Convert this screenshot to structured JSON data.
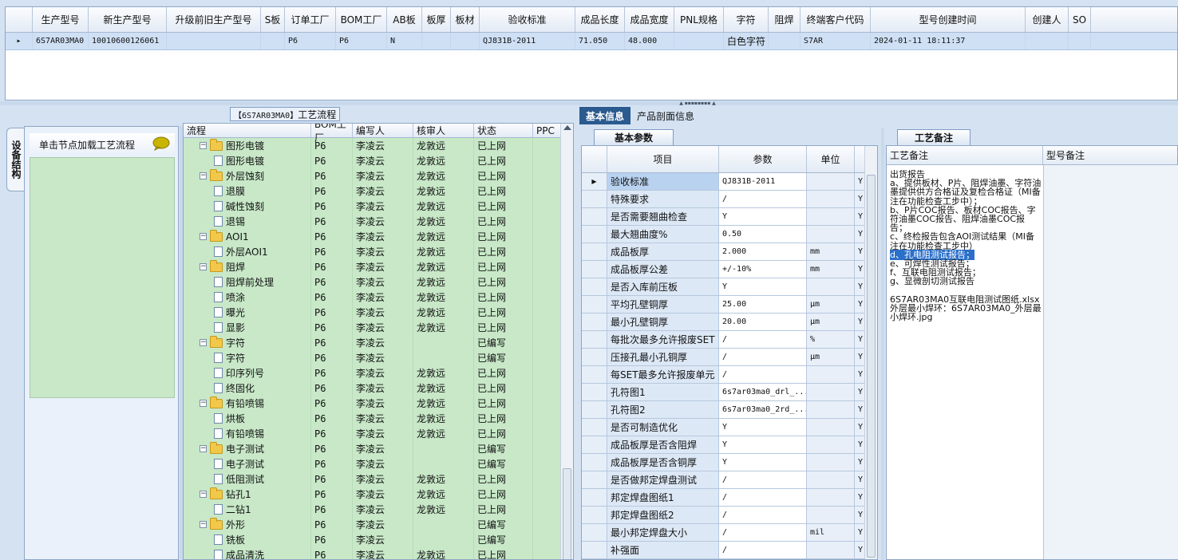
{
  "top_grid": {
    "headers": [
      "生产型号",
      "新生产型号",
      "升级前旧生产型号",
      "S板",
      "订单工厂",
      "BOM工厂",
      "AB板",
      "板厚",
      "板材",
      "验收标准",
      "成品长度",
      "成品宽度",
      "PNL规格",
      "字符",
      "阻焊",
      "终端客户代码",
      "型号创建时间",
      "创建人",
      "SO"
    ],
    "row": [
      "6S7AR03MA0",
      "10010600126061",
      "",
      "",
      "P6",
      "P6",
      "N",
      "",
      "",
      "QJ831B-2011",
      "71.050",
      "48.000",
      "",
      "白色字符",
      "",
      "S7AR",
      "2024-01-11 18:11:37",
      "",
      ""
    ]
  },
  "left": {
    "title_part": "【6S7AR03MA0】",
    "title_suffix": "工艺流程",
    "vtab_label": "设备结构",
    "load_label": "单击节点加载工艺流程",
    "tree_headers": [
      "流程",
      "BOM工厂",
      "编写人",
      "核审人",
      "状态",
      "PPC"
    ],
    "tree_rows": [
      {
        "label": "图形电镀",
        "level": 0,
        "bom": "P6",
        "writer": "李凌云",
        "reviewer": "龙敦远",
        "status": "已上网"
      },
      {
        "label": "图形电镀",
        "level": 1,
        "bom": "P6",
        "writer": "李凌云",
        "reviewer": "龙敦远",
        "status": "已上网"
      },
      {
        "label": "外层蚀刻",
        "level": 0,
        "bom": "P6",
        "writer": "李凌云",
        "reviewer": "龙敦远",
        "status": "已上网"
      },
      {
        "label": "退膜",
        "level": 1,
        "bom": "P6",
        "writer": "李凌云",
        "reviewer": "龙敦远",
        "status": "已上网"
      },
      {
        "label": "碱性蚀刻",
        "level": 1,
        "bom": "P6",
        "writer": "李凌云",
        "reviewer": "龙敦远",
        "status": "已上网"
      },
      {
        "label": "退锡",
        "level": 1,
        "bom": "P6",
        "writer": "李凌云",
        "reviewer": "龙敦远",
        "status": "已上网"
      },
      {
        "label": "AOI1",
        "level": 0,
        "bom": "P6",
        "writer": "李凌云",
        "reviewer": "龙敦远",
        "status": "已上网"
      },
      {
        "label": "外层AOI1",
        "level": 1,
        "bom": "P6",
        "writer": "李凌云",
        "reviewer": "龙敦远",
        "status": "已上网"
      },
      {
        "label": "阻焊",
        "level": 0,
        "bom": "P6",
        "writer": "李凌云",
        "reviewer": "龙敦远",
        "status": "已上网"
      },
      {
        "label": "阻焊前处理",
        "level": 1,
        "bom": "P6",
        "writer": "李凌云",
        "reviewer": "龙敦远",
        "status": "已上网"
      },
      {
        "label": "喷涂",
        "level": 1,
        "bom": "P6",
        "writer": "李凌云",
        "reviewer": "龙敦远",
        "status": "已上网"
      },
      {
        "label": "曝光",
        "level": 1,
        "bom": "P6",
        "writer": "李凌云",
        "reviewer": "龙敦远",
        "status": "已上网"
      },
      {
        "label": "显影",
        "level": 1,
        "bom": "P6",
        "writer": "李凌云",
        "reviewer": "龙敦远",
        "status": "已上网"
      },
      {
        "label": "字符",
        "level": 0,
        "bom": "P6",
        "writer": "李凌云",
        "reviewer": "",
        "status": "已编写"
      },
      {
        "label": "字符",
        "level": 1,
        "bom": "P6",
        "writer": "李凌云",
        "reviewer": "",
        "status": "已编写"
      },
      {
        "label": "印序列号",
        "level": 1,
        "bom": "P6",
        "writer": "李凌云",
        "reviewer": "龙敦远",
        "status": "已上网"
      },
      {
        "label": "终固化",
        "level": 1,
        "bom": "P6",
        "writer": "李凌云",
        "reviewer": "龙敦远",
        "status": "已上网"
      },
      {
        "label": "有铅喷锡",
        "level": 0,
        "bom": "P6",
        "writer": "李凌云",
        "reviewer": "龙敦远",
        "status": "已上网"
      },
      {
        "label": "烘板",
        "level": 1,
        "bom": "P6",
        "writer": "李凌云",
        "reviewer": "龙敦远",
        "status": "已上网"
      },
      {
        "label": "有铅喷锡",
        "level": 1,
        "bom": "P6",
        "writer": "李凌云",
        "reviewer": "龙敦远",
        "status": "已上网"
      },
      {
        "label": "电子测试",
        "level": 0,
        "bom": "P6",
        "writer": "李凌云",
        "reviewer": "",
        "status": "已编写"
      },
      {
        "label": "电子测试",
        "level": 1,
        "bom": "P6",
        "writer": "李凌云",
        "reviewer": "",
        "status": "已编写"
      },
      {
        "label": "低阻测试",
        "level": 1,
        "bom": "P6",
        "writer": "李凌云",
        "reviewer": "龙敦远",
        "status": "已上网"
      },
      {
        "label": "钻孔1",
        "level": 0,
        "bom": "P6",
        "writer": "李凌云",
        "reviewer": "龙敦远",
        "status": "已上网"
      },
      {
        "label": "二钻1",
        "level": 1,
        "bom": "P6",
        "writer": "李凌云",
        "reviewer": "龙敦远",
        "status": "已上网"
      },
      {
        "label": "外形",
        "level": 0,
        "bom": "P6",
        "writer": "李凌云",
        "reviewer": "",
        "status": "已编写"
      },
      {
        "label": "铣板",
        "level": 1,
        "bom": "P6",
        "writer": "李凌云",
        "reviewer": "",
        "status": "已编写"
      },
      {
        "label": "成品清洗",
        "level": 1,
        "bom": "P6",
        "writer": "李凌云",
        "reviewer": "龙敦远",
        "status": "已上网"
      }
    ]
  },
  "mid": {
    "tabs": [
      "基本信息",
      "产品剖面信息"
    ],
    "sub_tab": "基本参数",
    "headers": [
      "项目",
      "参数",
      "单位"
    ],
    "rows": [
      {
        "item": "验收标准",
        "value": "QJ831B-2011",
        "unit": "",
        "flag": "Y"
      },
      {
        "item": "特殊要求",
        "value": "/",
        "unit": "",
        "flag": "Y"
      },
      {
        "item": "是否需要翘曲检查",
        "value": "Y",
        "unit": "",
        "flag": "Y"
      },
      {
        "item": "最大翘曲度%",
        "value": "0.50",
        "unit": "",
        "flag": "Y"
      },
      {
        "item": "成品板厚",
        "value": "2.000",
        "unit": "mm",
        "flag": "Y"
      },
      {
        "item": "成品板厚公差",
        "value": "+/-10%",
        "unit": "mm",
        "flag": "Y"
      },
      {
        "item": "是否入库前压板",
        "value": "Y",
        "unit": "",
        "flag": "Y"
      },
      {
        "item": "平均孔壁铜厚",
        "value": "25.00",
        "unit": "μm",
        "flag": "Y"
      },
      {
        "item": "最小孔壁铜厚",
        "value": "20.00",
        "unit": "μm",
        "flag": "Y"
      },
      {
        "item": "每批次最多允许报废SET",
        "value": "/",
        "unit": "%",
        "flag": "Y"
      },
      {
        "item": "压接孔最小孔铜厚",
        "value": "/",
        "unit": "μm",
        "flag": "Y"
      },
      {
        "item": "每SET最多允许报废单元",
        "value": "/",
        "unit": "",
        "flag": "Y"
      },
      {
        "item": "孔符图1",
        "value": "6s7ar03ma0_drl_...",
        "unit": "",
        "flag": "Y"
      },
      {
        "item": "孔符图2",
        "value": "6s7ar03ma0_2rd_...",
        "unit": "",
        "flag": "Y"
      },
      {
        "item": "是否可制造优化",
        "value": "Y",
        "unit": "",
        "flag": "Y"
      },
      {
        "item": "成品板厚是否含阻焊",
        "value": "Y",
        "unit": "",
        "flag": "Y"
      },
      {
        "item": "成品板厚是否含铜厚",
        "value": "Y",
        "unit": "",
        "flag": "Y"
      },
      {
        "item": "是否做邦定焊盘测试",
        "value": "/",
        "unit": "",
        "flag": "Y"
      },
      {
        "item": "邦定焊盘图纸1",
        "value": "/",
        "unit": "",
        "flag": "Y"
      },
      {
        "item": "邦定焊盘图纸2",
        "value": "/",
        "unit": "",
        "flag": "Y"
      },
      {
        "item": "最小邦定焊盘大小",
        "value": "/",
        "unit": "mil",
        "flag": "Y"
      },
      {
        "item": "补强面",
        "value": "/",
        "unit": "",
        "flag": "Y"
      }
    ]
  },
  "right": {
    "tab": "工艺备注",
    "col1": "工艺备注",
    "col2": "型号备注",
    "note_before": "出货报告\na、提供板材、P片、阻焊油墨、字符油墨提供供方合格证及复检合格证（MI备注在功能检查工步中）；\nb、P片COC报告、板材COC报告、字符油墨COC报告、阻焊油墨COC报告；\nc、终检报告包含AOI测试结果（MI备注在功能检查工步中）\n",
    "note_highlight": "d、孔电阻测试报告；",
    "note_after": "\ne、可焊性测试报告；\nf、互联电阻测试报告；\ng、显微剖切测试报告\n\n6S7AR03MA0互联电阻测试图纸.xlsx\n外层最小焊环：6S7AR03MA0_外层最小焊环.jpg"
  }
}
